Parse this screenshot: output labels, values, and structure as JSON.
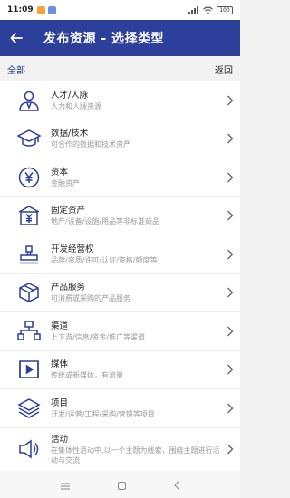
{
  "status": {
    "time": "11:09",
    "battery": "100"
  },
  "header": {
    "title": "发布资源 - 选择类型"
  },
  "subheader": {
    "category": "全部",
    "return_label": "返回"
  },
  "items": [
    {
      "icon": "person-icon",
      "title": "人才/人脉",
      "desc": "人力和人脉资源"
    },
    {
      "icon": "graduation-cap-icon",
      "title": "数据/技术",
      "desc": "可合作的数据和技术资产"
    },
    {
      "icon": "yen-coin-icon",
      "title": "资本",
      "desc": "金融资产"
    },
    {
      "icon": "building-yen-icon",
      "title": "固定资产",
      "desc": "地产/设备/设施/用品等非标准商品"
    },
    {
      "icon": "stamp-icon",
      "title": "开发经营权",
      "desc": "品牌/资质/许可/认证/资格/额度等"
    },
    {
      "icon": "box-icon",
      "title": "产品服务",
      "desc": "可消费或采购的产品服务"
    },
    {
      "icon": "network-icon",
      "title": "渠道",
      "desc": "上下游/信息/资金/推广等渠道"
    },
    {
      "icon": "play-icon",
      "title": "媒体",
      "desc": "传统或新媒体，有流量"
    },
    {
      "icon": "layers-icon",
      "title": "项目",
      "desc": "开发/运营/工程/采购/营销等项目"
    },
    {
      "icon": "speaker-icon",
      "title": "活动",
      "desc": "在集体性活动中,以一个主题为线索，围绕主题进行活动与交流"
    }
  ]
}
